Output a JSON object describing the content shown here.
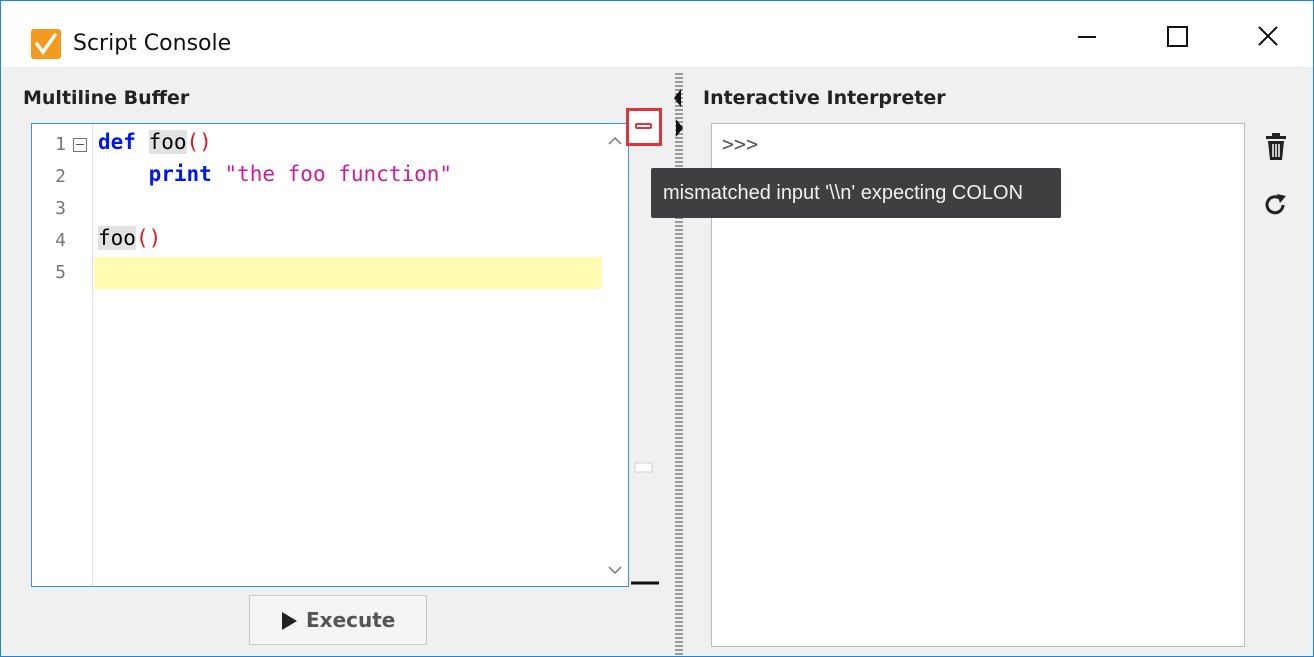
{
  "window": {
    "title": "Script Console",
    "accent_color": "#1e83d8",
    "icon": "script-console-app-icon"
  },
  "titlebar_buttons": [
    "minimize-icon",
    "maximize-icon",
    "close-icon"
  ],
  "multiline": {
    "label": "Multiline Buffer",
    "line_numbers": [
      "1",
      "2",
      "3",
      "4",
      "5"
    ],
    "code": {
      "line1_kw": "def",
      "line1_name": "foo",
      "line1_paren": "()",
      "line2_kw": "print",
      "line2_str": "\"the foo function\"",
      "line4_name": "foo",
      "line4_paren": "()"
    },
    "error_tooltip": "mismatched input '\\\\n' expecting COLON",
    "execute_label": "Execute"
  },
  "interpreter": {
    "label": "Interactive Interpreter",
    "prompt": ">>>",
    "side_icons": [
      "trash-icon",
      "refresh-icon"
    ]
  },
  "colors": {
    "keyword": "#0018e8",
    "string": "#d2189a",
    "paren": "#e01818",
    "current_line": "#fffbb0",
    "error_marker": "#e0333b"
  }
}
